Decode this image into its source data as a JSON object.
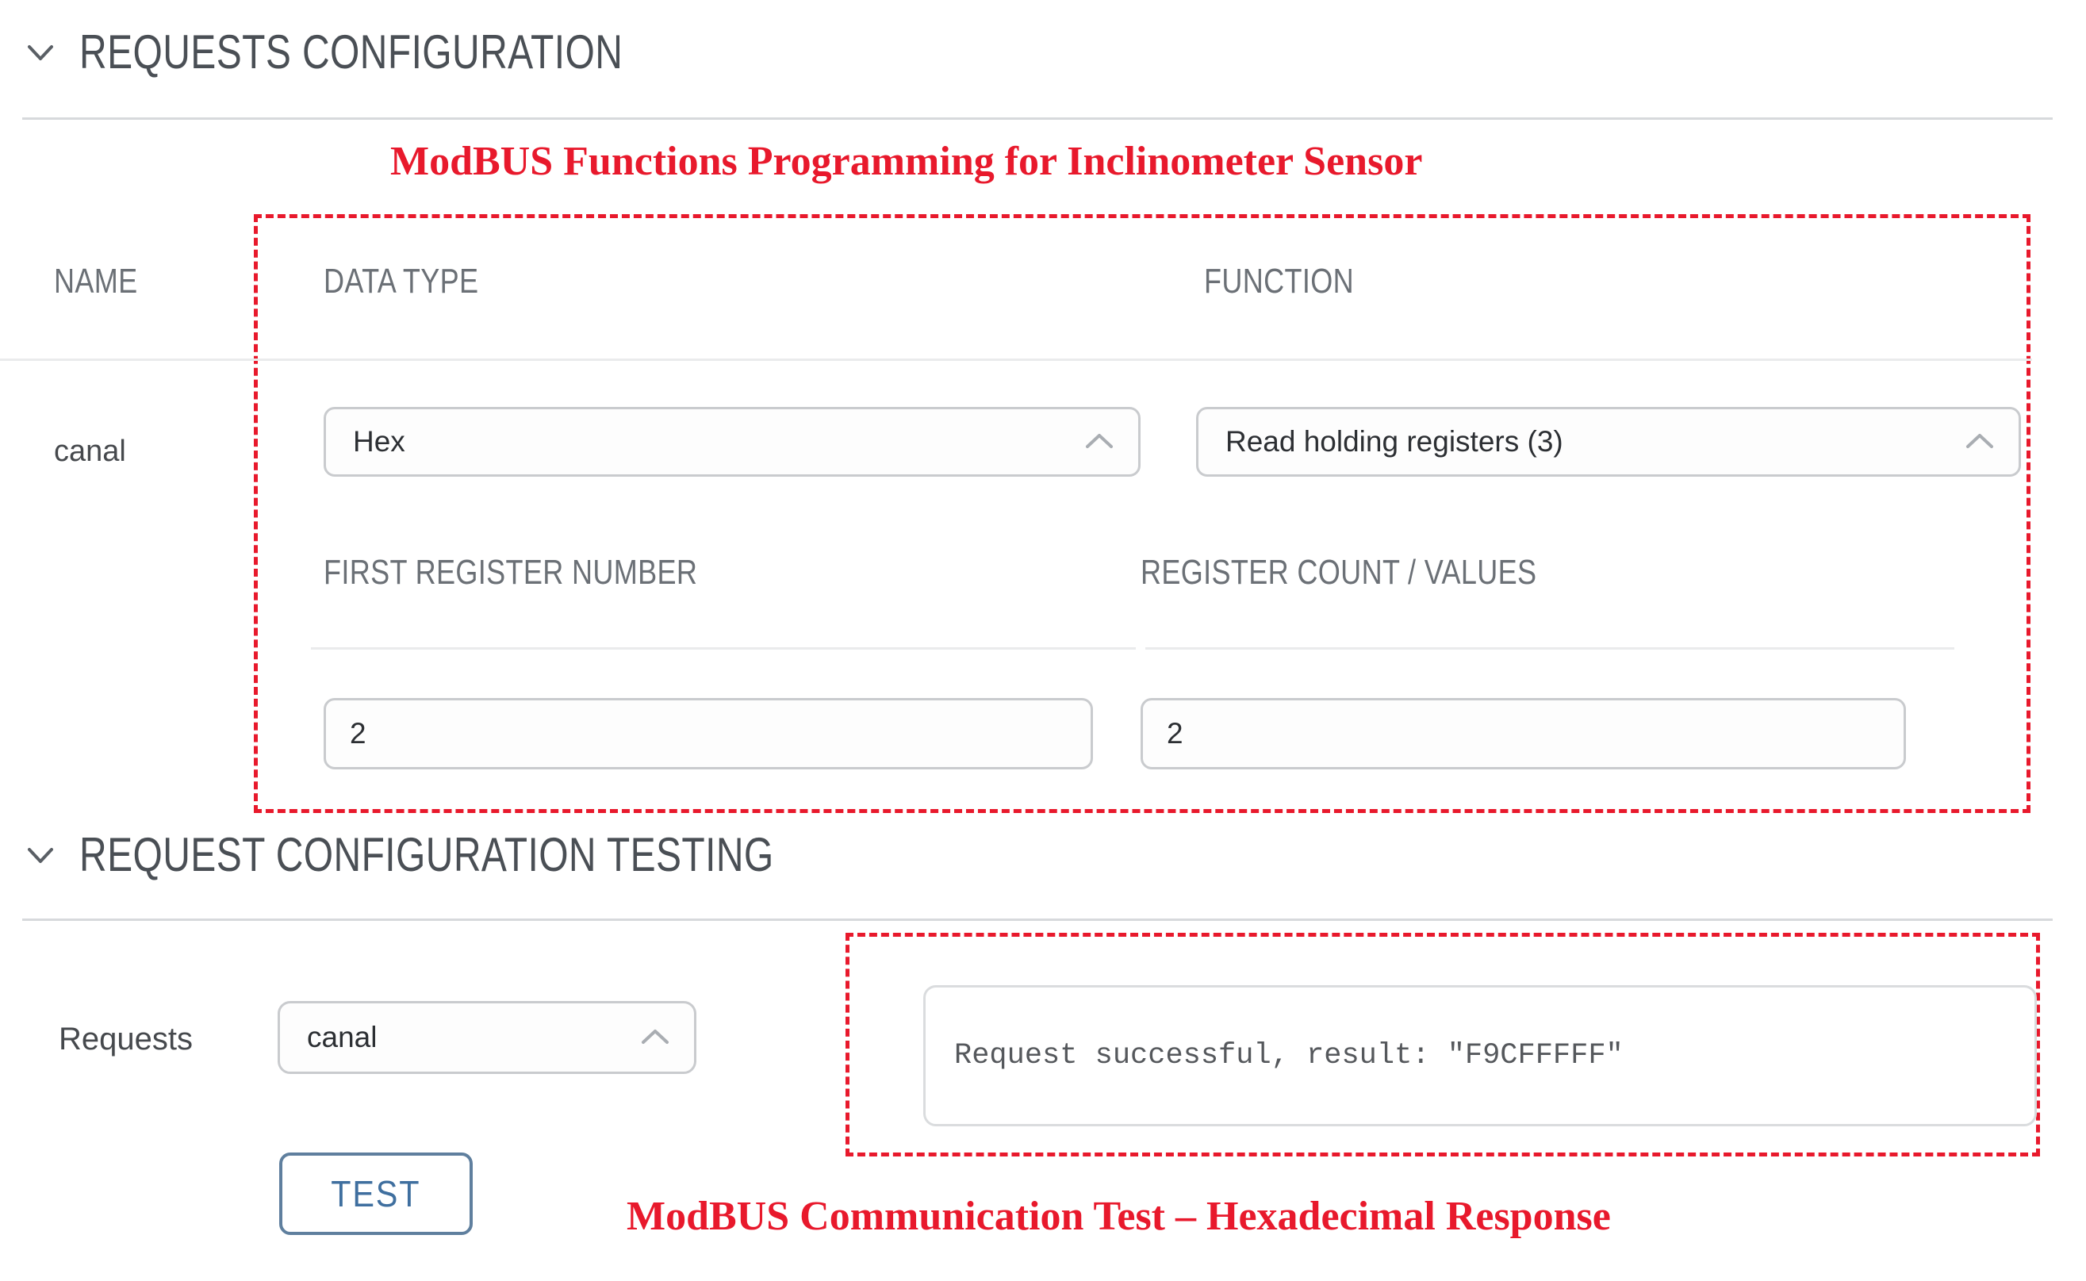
{
  "sections": {
    "requests_configuration": {
      "title": "REQUESTS CONFIGURATION",
      "toggle_icon": "chevron-down-icon"
    },
    "request_configuration_testing": {
      "title": "REQUEST CONFIGURATION TESTING",
      "toggle_icon": "chevron-down-icon"
    }
  },
  "annotations": {
    "top": "ModBUS Functions Programming for Inclinometer Sensor",
    "bottom": "ModBUS Communication Test – Hexadecimal Response",
    "color": "#E8192C"
  },
  "requests_table": {
    "headers": {
      "name": "NAME",
      "data_type": "DATA TYPE",
      "function": "FUNCTION"
    },
    "sub_headers": {
      "first_register_number": "FIRST REGISTER NUMBER",
      "register_count_values": "REGISTER COUNT / VALUES"
    },
    "row": {
      "name": "canal",
      "data_type": {
        "value": "Hex",
        "chevron_icon": "chevron-up-icon"
      },
      "function": {
        "value": "Read holding registers (3)",
        "chevron_icon": "chevron-up-icon"
      },
      "first_register_number": {
        "value": "2",
        "placeholder": "First register number"
      },
      "register_count_values": {
        "value": "2",
        "placeholder": "Register count / values"
      }
    }
  },
  "testing": {
    "requests_label": "Requests",
    "requests_select": {
      "value": "canal",
      "chevron_icon": "chevron-up-icon"
    },
    "test_button_label": "TEST",
    "result": "Request successful, result: \"F9CFFFFF\"",
    "accent_color": "#3F6F9F"
  }
}
